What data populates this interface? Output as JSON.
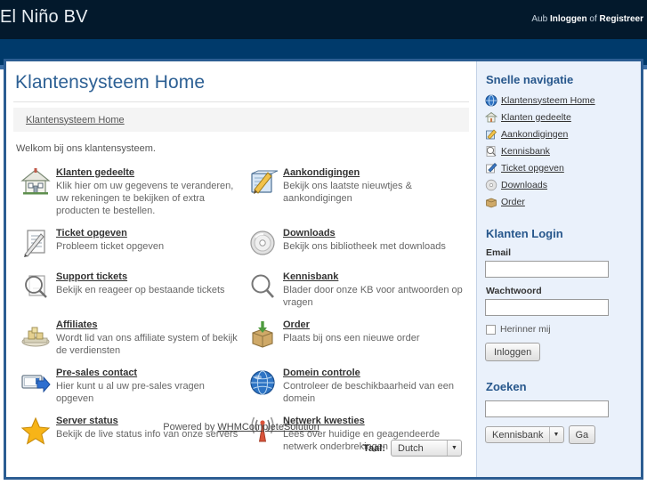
{
  "header": {
    "brand": "El Niño BV",
    "account_prefix": "Aub ",
    "login_label": "Inloggen",
    "account_sep": " of ",
    "register_label": "Registreer"
  },
  "main": {
    "page_title": "Klantensysteem Home",
    "breadcrumb": "Klantensysteem Home",
    "welcome": "Welkom bij ons klantensysteem.",
    "tiles": [
      {
        "icon": "house-icon",
        "title": "Klanten gedeelte",
        "desc": "Klik hier om uw gegevens te veranderen, uw rekeningen te bekijken of extra producten te bestellen."
      },
      {
        "icon": "notepad-pencil-icon",
        "title": "Aankondigingen",
        "desc": "Bekijk ons laatste nieuwtjes & aankondigingen"
      },
      {
        "icon": "document-pencil-icon",
        "title": "Ticket opgeven",
        "desc": "Probleem ticket opgeven"
      },
      {
        "icon": "cd-disc-icon",
        "title": "Downloads",
        "desc": "Bekijk ons bibliotheek met downloads"
      },
      {
        "icon": "magnifier-document-icon",
        "title": "Support tickets",
        "desc": "Bekijk en reageer op bestaande tickets"
      },
      {
        "icon": "magnifier-icon",
        "title": "Kennisbank",
        "desc": "Blader door onze KB voor antwoorden op vragen"
      },
      {
        "icon": "money-stack-icon",
        "title": "Affiliates",
        "desc": "Wordt lid van ons affiliate system of bekijk de verdiensten"
      },
      {
        "icon": "box-arrow-down-icon",
        "title": "Order",
        "desc": "Plaats bij ons een nieuwe order"
      },
      {
        "icon": "screen-arrow-icon",
        "title": "Pre-sales contact",
        "desc": "Hier kunt u al uw pre-sales vragen opgeven"
      },
      {
        "icon": "globe-icon",
        "title": "Domein controle",
        "desc": "Controleer de beschikbaarheid van een domein"
      },
      {
        "icon": "star-icon",
        "title": "Server status",
        "desc": "Bekijk de live status info van onze servers"
      },
      {
        "icon": "antenna-signal-icon",
        "title": "Netwerk kwesties",
        "desc": "Lees over huidige en geagendeerde netwerk onderbrekingen"
      }
    ],
    "powered_prefix": "Powered by ",
    "powered_link": "WHMCompleteSolution",
    "language_label": "Taal:",
    "language_value": "Dutch"
  },
  "sidebar": {
    "nav_heading": "Snelle navigatie",
    "nav_items": [
      {
        "icon": "globe-blue-icon",
        "label": "Klantensysteem Home"
      },
      {
        "icon": "house-small-icon",
        "label": "Klanten gedeelte"
      },
      {
        "icon": "announce-icon",
        "label": "Aankondigingen"
      },
      {
        "icon": "magnifier-small-icon",
        "label": "Kennisbank"
      },
      {
        "icon": "ticket-edit-icon",
        "label": "Ticket opgeven"
      },
      {
        "icon": "cd-small-icon",
        "label": "Downloads"
      },
      {
        "icon": "box-small-icon",
        "label": "Order"
      }
    ],
    "login_heading": "Klanten Login",
    "email_label": "Email",
    "email_value": "",
    "password_label": "Wachtwoord",
    "password_value": "",
    "remember_label": "Herinner mij",
    "login_button": "Inloggen",
    "search_heading": "Zoeken",
    "search_value": "",
    "search_scope": "Kennisbank",
    "search_button": "Ga"
  },
  "colors": {
    "header_dark": "#03192c",
    "nav_blue": "#003a6b",
    "border_blue": "#2c5d92",
    "sidebar_bg": "#eaf1fb",
    "title_blue": "#2d6094",
    "heading_blue": "#27578c"
  }
}
